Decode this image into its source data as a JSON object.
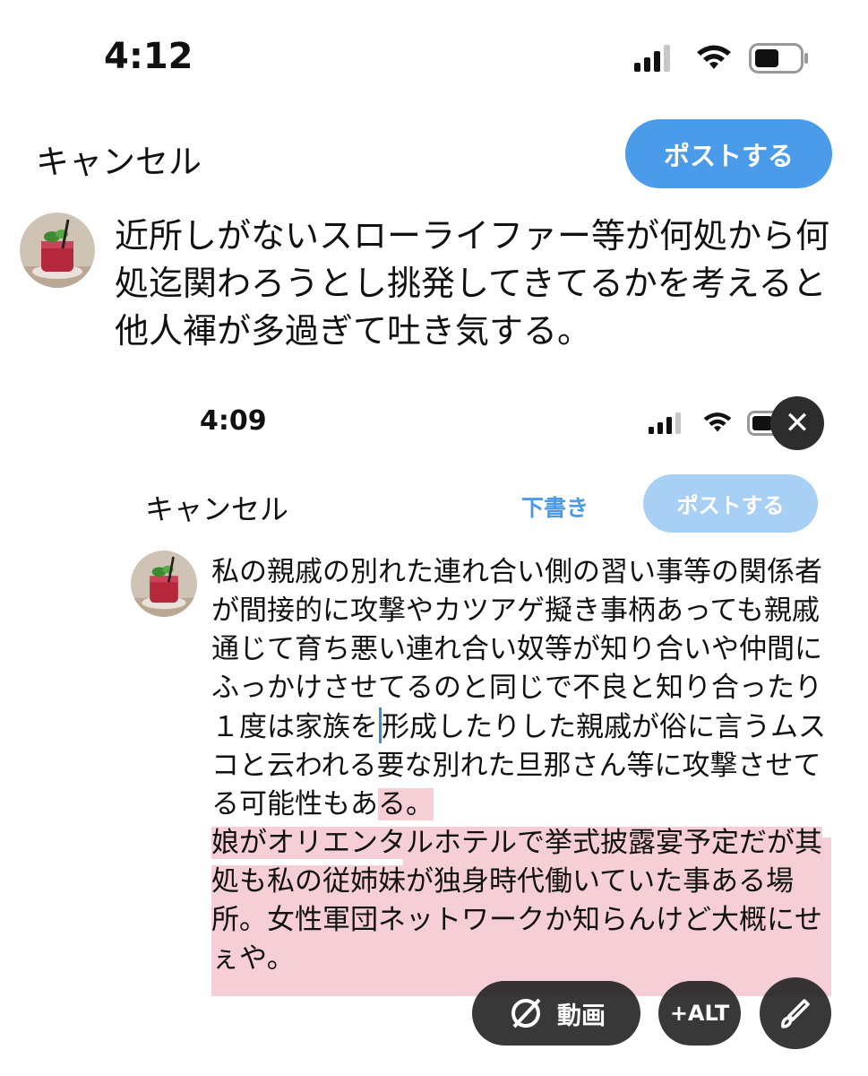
{
  "status_bar": {
    "time": "4:12"
  },
  "compose": {
    "cancel_label": "キャンセル",
    "post_label": "ポストする",
    "text": "近所しがないスローライファー等が何処から何処迄関わろうとし挑発してきてるかを考えると他人褌が多過ぎて吐き気する。"
  },
  "attached_image": {
    "status_time": "4:09",
    "cancel_label": "キャンセル",
    "drafts_label": "下書き",
    "post_label": "ポストする",
    "body_para1": "私の親戚の別れた連れ合い側の習い事等の関係者が間接的に攻撃やカツアゲ擬き事柄あっても親戚通じて育ち悪い連れ合い奴等が知り合いや仲間にふっかけさせてるのと同じで不良と知り合ったり１度は家族を",
    "body_para1b": "形成したりした親戚が俗に言うムスコと云われる要な別れた旦那さん等に攻撃させてる可能性もあ",
    "body_para1c": "る。",
    "body_para2": "娘がオリエンタルホテルで挙式披露宴予定だが其処も私の従姉妹が独身時代働いていた事ある場所。女性軍団ネットワークか知らんけど大概にせぇや。",
    "video_label": "動画",
    "alt_label": "+ALT"
  },
  "colors": {
    "accent": "#4a9bea",
    "accent_disabled": "#a8d0f5",
    "highlight": "#f6cfd6"
  },
  "icons": [
    "signal-icon",
    "wifi-icon",
    "battery-icon",
    "close-icon",
    "video-edit-icon",
    "brush-icon"
  ]
}
